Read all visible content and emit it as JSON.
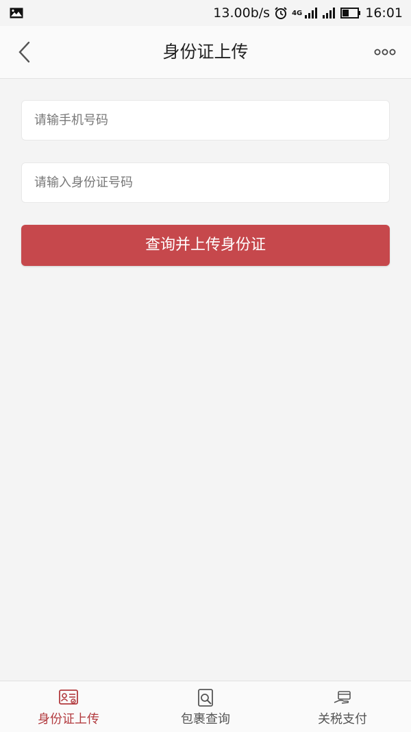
{
  "status_bar": {
    "network_speed": "13.00b/s",
    "network_type": "4G",
    "time": "16:01"
  },
  "navbar": {
    "title": "身份证上传"
  },
  "form": {
    "phone_placeholder": "请输手机号码",
    "id_placeholder": "请输入身份证号码",
    "submit_label": "查询并上传身份证"
  },
  "tabs": [
    {
      "label": "身份证上传",
      "icon": "id-card-icon",
      "active": true
    },
    {
      "label": "包裹查询",
      "icon": "package-search-icon",
      "active": false
    },
    {
      "label": "关税支付",
      "icon": "payment-hand-icon",
      "active": false
    }
  ],
  "colors": {
    "accent": "#c6484c",
    "active_tab": "#b23a3e",
    "background": "#f4f4f4"
  }
}
